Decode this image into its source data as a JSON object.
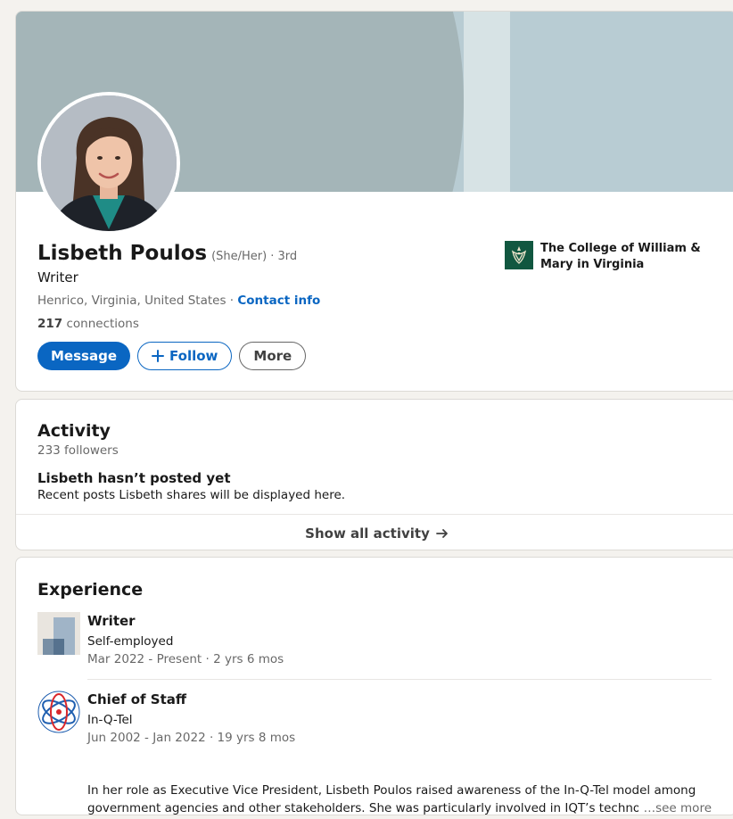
{
  "profile": {
    "name": "Lisbeth Poulos",
    "pronouns": "(She/Her)",
    "degree": "· 3rd",
    "headline": "Writer",
    "location": "Henrico, Virginia, United States",
    "location_separator": "·",
    "contact_info": "Contact info",
    "connections_count": "217",
    "connections_label": "connections",
    "actions": {
      "message": "Message",
      "follow": "Follow",
      "more": "More"
    },
    "education": {
      "school": "The College of William & Mary in Virginia",
      "logo_icon": "william-mary-crest-icon"
    }
  },
  "activity": {
    "title": "Activity",
    "followers": "233 followers",
    "empty_title": "Lisbeth hasn’t posted yet",
    "empty_subtitle": "Recent posts Lisbeth shares will be displayed here.",
    "show_all": "Show all activity",
    "show_all_icon": "arrow-right-icon"
  },
  "experience": {
    "title": "Experience",
    "items": [
      {
        "title": "Writer",
        "company": "Self-employed",
        "dates": "Mar 2022 - Present · 2 yrs 6 mos",
        "logo_icon": "company-placeholder-icon"
      },
      {
        "title": "Chief of Staff",
        "company": "In-Q-Tel",
        "dates": "Jun 2002 - Jan 2022 · 19 yrs 8 mos",
        "description": "In her role as Executive Vice President, Lisbeth Poulos raised awareness of the In-Q-Tel model among government agencies and other stakeholders. She was particularly involved in IQT’s technology",
        "see_more": "…see more",
        "logo_icon": "in-q-tel-logo-icon"
      }
    ]
  },
  "colors": {
    "brand_blue": "#0a66c2",
    "banner_light": "#b8ccd3",
    "banner_dark": "#a4b5b8",
    "school_green": "#115740"
  }
}
